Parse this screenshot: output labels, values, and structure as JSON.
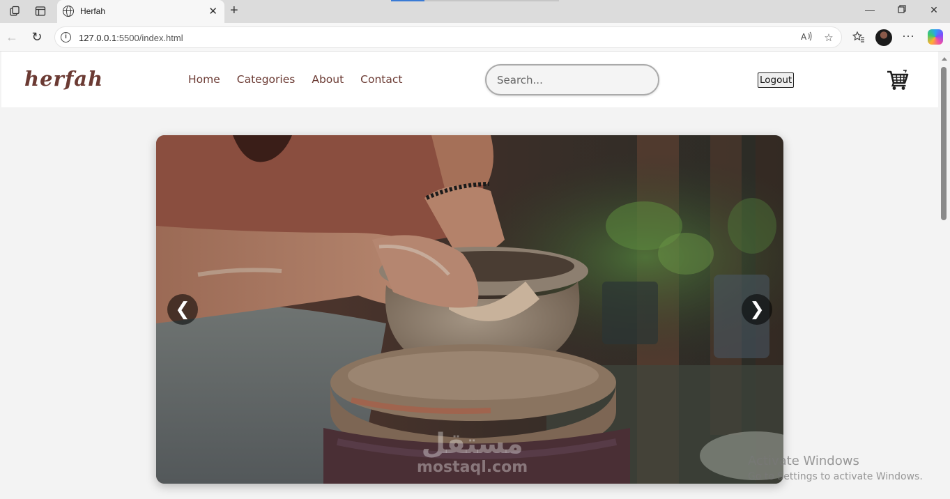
{
  "browser": {
    "tab_title": "Herfah",
    "url_host": "127.0.0.1",
    "url_rest": ":5500/index.html"
  },
  "site": {
    "logo": "herfah",
    "nav": [
      "Home",
      "Categories",
      "About",
      "Contact"
    ],
    "search_placeholder": "Search...",
    "logout_label": "Logout"
  },
  "slider": {
    "prev_label": "❮",
    "next_label": "❯",
    "image_alt": "Potter shaping a clay pot on a wheel"
  },
  "overlay": {
    "watermark_ar": "مستقل",
    "watermark_en": "mostaql.com",
    "activate_line1": "Activate Windows",
    "activate_line2": "Go to Settings to activate Windows."
  },
  "colors": {
    "brand": "#6b3a33",
    "header_bg": "#ffffff",
    "page_bg": "#f3f3f3"
  }
}
